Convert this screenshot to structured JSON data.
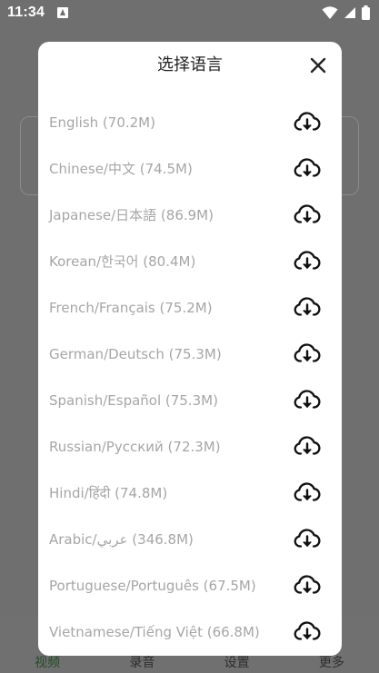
{
  "status_bar": {
    "time": "11:34",
    "notification_icon": "app-notification-icon",
    "wifi_icon": "wifi-icon",
    "signal_icon": "signal-icon",
    "battery_icon": "battery-icon"
  },
  "bottom_nav": {
    "tabs": [
      {
        "label": "视频",
        "icon": "video-icon",
        "active": true
      },
      {
        "label": "录音",
        "icon": "microphone-icon",
        "active": false
      },
      {
        "label": "设置",
        "icon": "settings-icon",
        "active": false
      },
      {
        "label": "更多",
        "icon": "more-icon",
        "active": false
      }
    ]
  },
  "dialog": {
    "title": "选择语言",
    "close_icon": "close-icon",
    "languages": [
      {
        "label": "English (70.2M)",
        "icon": "cloud-download-icon"
      },
      {
        "label": "Chinese/中文 (74.5M)",
        "icon": "cloud-download-icon"
      },
      {
        "label": "Japanese/日本語 (86.9M)",
        "icon": "cloud-download-icon"
      },
      {
        "label": "Korean/한국어 (80.4M)",
        "icon": "cloud-download-icon"
      },
      {
        "label": "French/Français (75.2M)",
        "icon": "cloud-download-icon"
      },
      {
        "label": "German/Deutsch (75.3M)",
        "icon": "cloud-download-icon"
      },
      {
        "label": "Spanish/Español (75.3M)",
        "icon": "cloud-download-icon"
      },
      {
        "label": "Russian/Русский (72.3M)",
        "icon": "cloud-download-icon"
      },
      {
        "label": "Hindi/हिंदी (74.8M)",
        "icon": "cloud-download-icon"
      },
      {
        "label": "Arabic/عربي (346.8M)",
        "icon": "cloud-download-icon"
      },
      {
        "label": "Portuguese/Português (67.5M)",
        "icon": "cloud-download-icon"
      },
      {
        "label": "Vietnamese/Tiếng Việt (66.8M)",
        "icon": "cloud-download-icon"
      }
    ]
  }
}
